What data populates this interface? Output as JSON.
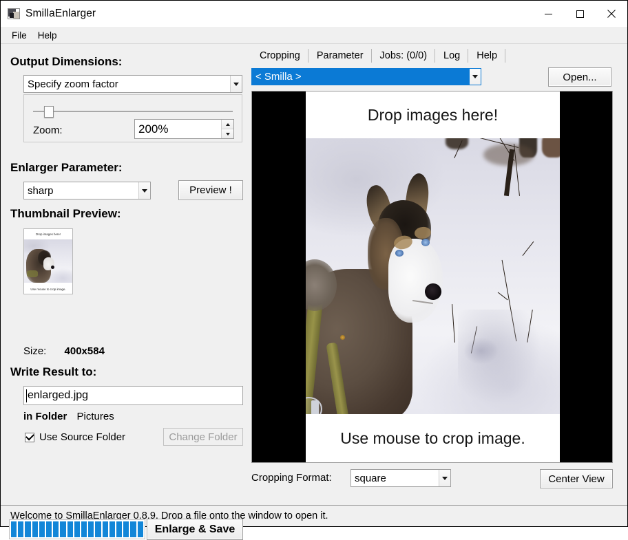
{
  "window": {
    "title": "SmillaEnlarger",
    "icon": "app-image-icon",
    "buttons": {
      "minimize": "minimize-icon",
      "maximize": "maximize-icon",
      "close": "close-icon"
    }
  },
  "menu": {
    "items": [
      "File",
      "Help"
    ]
  },
  "left": {
    "output_dimensions": {
      "label": "Output Dimensions:",
      "mode_combo_value": "Specify zoom factor",
      "zoom_label": "Zoom:",
      "zoom_value": "200%",
      "slider_position_percent": 8
    },
    "enlarger_parameter": {
      "label": "Enlarger Parameter:",
      "preset_combo_value": "sharp",
      "preview_button": "Preview !"
    },
    "thumbnail_preview": {
      "label": "Thumbnail Preview:",
      "top_caption": "Drop images here!",
      "bottom_caption": "Use mouse to crop image.",
      "size_label": "Size:",
      "size_value": "400x584"
    },
    "write_result": {
      "label": "Write Result to:",
      "filename_value": "enlarged.jpg",
      "filename_placeholder": "enlarged.jpg",
      "folder_label": "in Folder",
      "folder_value": "Pictures",
      "use_source_folder_label": "Use Source Folder",
      "use_source_folder_checked": true,
      "change_folder_button": "Change Folder",
      "change_folder_enabled": false
    },
    "bottom": {
      "progress_segments": 19,
      "progress_percent": 100,
      "enlarge_save_button": "Enlarge & Save"
    }
  },
  "right": {
    "tabs": [
      {
        "label": "Cropping",
        "selected": true
      },
      {
        "label": "Parameter",
        "selected": false
      },
      {
        "label": "Jobs: (0/0)",
        "selected": false
      },
      {
        "label": "Log",
        "selected": false
      },
      {
        "label": "Help",
        "selected": false
      }
    ],
    "source_combo_value": "< Smilla >",
    "open_button": "Open...",
    "preview": {
      "top_caption": "Drop images here!",
      "bottom_caption": "Use mouse to crop image."
    },
    "cropping_format_label": "Cropping Format:",
    "cropping_format_value": "square",
    "center_view_button": "Center View"
  },
  "statusbar": {
    "text": "Welcome to SmillaEnlarger 0.8.9.  Drop a file onto the window to open it."
  },
  "colors": {
    "accent_blue": "#1286d8",
    "selection_blue": "#0b7ad5",
    "window_bg": "#f0f0f0",
    "panel_black": "#000000"
  }
}
